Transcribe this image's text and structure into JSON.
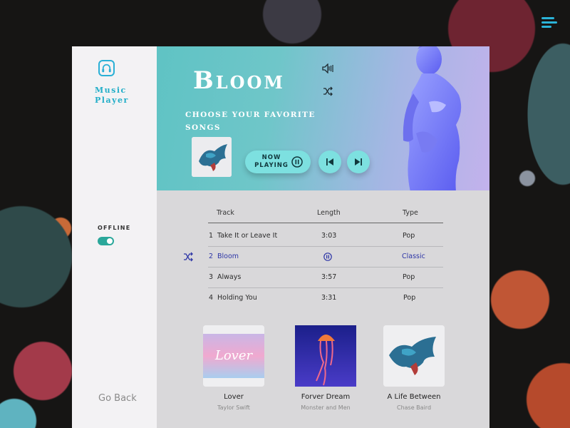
{
  "app": {
    "title": "Music Player",
    "offline_label": "Offline",
    "offline_enabled": true,
    "go_back_label": "Go Back"
  },
  "hero": {
    "title": "Bloom",
    "subtitle": "Choose your favorite songs",
    "now_playing_label": "Now Playing"
  },
  "table": {
    "headers": [
      "Track",
      "Length",
      "Type"
    ],
    "rows": [
      {
        "num": "1",
        "track": "Take It or Leave It",
        "length": "3:03",
        "type": "Pop",
        "active": false
      },
      {
        "num": "2",
        "track": "Bloom",
        "length": "",
        "type": "Classic",
        "active": true
      },
      {
        "num": "3",
        "track": "Always",
        "length": "3:57",
        "type": "Pop",
        "active": false
      },
      {
        "num": "4",
        "track": "Holding You",
        "length": "3:31",
        "type": "Pop",
        "active": false
      }
    ]
  },
  "albums": [
    {
      "title": "Lover",
      "artist": "Taylor Swift",
      "art_text": "Lover"
    },
    {
      "title": "Forver Dream",
      "artist": "Monster and  Men"
    },
    {
      "title": "A Life Between",
      "artist": "Chase Baird"
    }
  ],
  "icons": {
    "menu": "hamburger-menu-icon",
    "logo": "headphones-icon",
    "volume": "volume-icon",
    "shuffle": "shuffle-icon",
    "pause": "pause-icon",
    "previous": "skip-previous-icon",
    "next": "skip-next-icon"
  },
  "colors": {
    "accent": "#22aec8",
    "button": "#7de0e0",
    "toggle": "#2aa79a",
    "active_row": "#2d35a6"
  }
}
